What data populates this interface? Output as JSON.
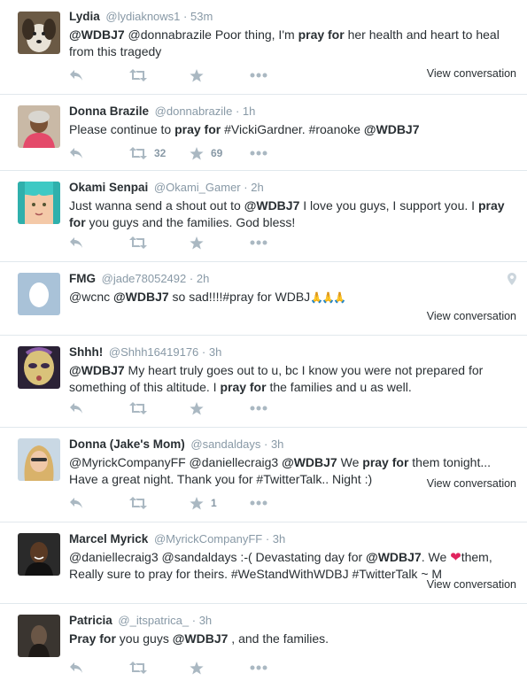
{
  "colors": {
    "accent": "#55acee",
    "muted": "#8899a6",
    "icon": "#aab8c2",
    "heart": "#e0245e"
  },
  "tweets": [
    {
      "name": "Lydia",
      "handle": "@lydiaknows1",
      "dot": "·",
      "time": "53m",
      "parts": [
        "@WDBJ7",
        " @donnabrazile Poor thing, I'm ",
        "pray for",
        " her health and heart to heal from this tragedy"
      ],
      "view_conversation": "View conversation"
    },
    {
      "name": "Donna Brazile",
      "handle": "@donnabrazile",
      "dot": "·",
      "time": "1h",
      "parts": [
        "Please continue to ",
        "pray for",
        " #VickiGardner. #roanoke ",
        "@WDBJ7"
      ],
      "retweets": "32",
      "favorites": "69"
    },
    {
      "name": "Okami Senpai",
      "handle": "@Okami_Gamer",
      "dot": "·",
      "time": "2h",
      "parts": [
        "Just wanna send a shout out to ",
        "@WDBJ7",
        " I love you guys, I support you. I ",
        "pray for",
        " you guys and the families. God bless!"
      ]
    },
    {
      "name": "FMG",
      "handle": "@jade78052492",
      "dot": "·",
      "time": "2h",
      "parts": [
        "@wcnc ",
        "@WDBJ7",
        " so sad!!!!#pray for WDBJ",
        "🙏🙏🙏"
      ],
      "view_conversation": "View conversation"
    },
    {
      "name": "Shhh!",
      "handle": "@Shhh16419176",
      "dot": "·",
      "time": "3h",
      "parts": [
        "@WDBJ7",
        " My heart truly goes out to u, bc I know you were not prepared for something of this altitude. I ",
        "pray for",
        " the families and u as well."
      ]
    },
    {
      "name": "Donna (Jake's Mom)",
      "handle": "@sandaldays",
      "dot": "·",
      "time": "3h",
      "parts": [
        "@MyrickCompanyFF @daniellecraig3 ",
        "@WDBJ7",
        " We ",
        "pray for",
        " them tonight... Have a great night. Thank you for #TwitterTalk.. Night :)"
      ],
      "favorites": "1",
      "view_conversation": "View conversation"
    },
    {
      "name": "Marcel Myrick",
      "handle": "@MyrickCompanyFF",
      "dot": "·",
      "time": "3h",
      "parts": [
        "@daniellecraig3 @sandaldays :-( Devastating day for ",
        "@WDBJ7",
        ". We ",
        "❤",
        "them, Really sure to pray for theirs. #WeStandWithWDBJ #TwitterTalk ~ M"
      ],
      "view_conversation": "View conversation"
    },
    {
      "name": "Patricia",
      "handle": "@_itspatrica_",
      "dot": "·",
      "time": "3h",
      "parts": [
        "Pray for",
        " you guys ",
        "@WDBJ7",
        " , and the families."
      ]
    }
  ]
}
